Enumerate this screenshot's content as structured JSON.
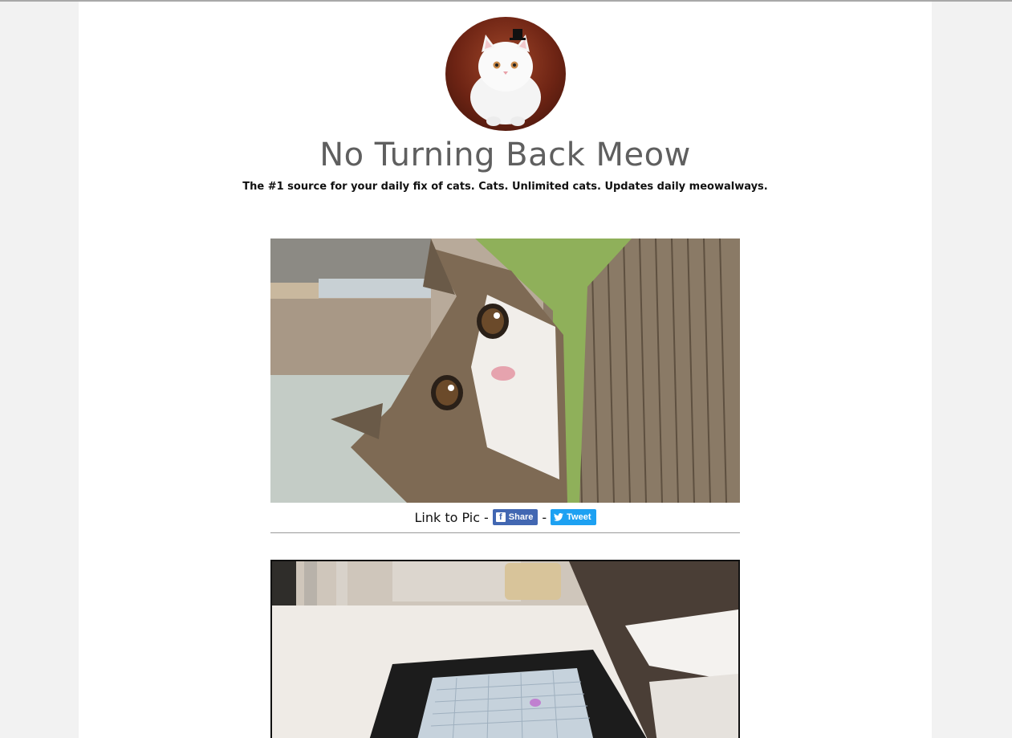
{
  "site": {
    "title": "No Turning Back Meow",
    "tagline": "The #1 source for your daily fix of cats. Cats. Unlimited cats. Updates daily meowalways."
  },
  "posts": [
    {
      "link_label": "Link to Pic",
      "separator": "-",
      "share_label": "Share",
      "tweet_label": "Tweet"
    },
    {}
  ],
  "colors": {
    "facebook": "#4267b2",
    "twitter": "#1da1f2",
    "title": "#5f5f5f"
  },
  "icons": {
    "facebook": "facebook-icon",
    "twitter": "twitter-bird-icon"
  }
}
